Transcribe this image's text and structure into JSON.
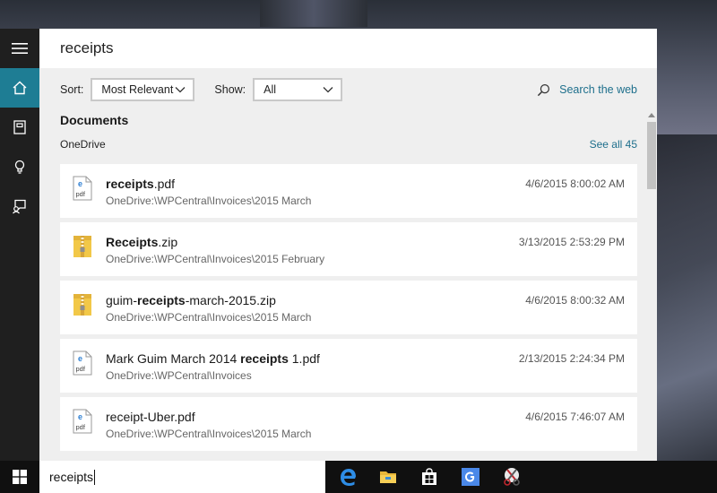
{
  "search": {
    "query": "receipts"
  },
  "filters": {
    "sort_label": "Sort:",
    "sort_value": "Most Relevant",
    "show_label": "Show:",
    "show_value": "All",
    "web_search_label": "Search the web"
  },
  "section": {
    "title": "Documents",
    "provider": "OneDrive",
    "see_all": "See all 45"
  },
  "results": [
    {
      "name_bold": "receipts",
      "name_after": ".pdf",
      "path": "OneDrive:\\WPCentral\\Invoices\\2015 March",
      "date": "4/6/2015 8:00:02 AM",
      "icon": "pdf-file-icon"
    },
    {
      "name_bold": "Receipts",
      "name_after": ".zip",
      "path": "OneDrive:\\WPCentral\\Invoices\\2015 February",
      "date": "3/13/2015 2:53:29 PM",
      "icon": "zip-folder-icon"
    },
    {
      "name_before": "guim-",
      "name_bold": "receipts",
      "name_after": "-march-2015.zip",
      "path": "OneDrive:\\WPCentral\\Invoices\\2015 March",
      "date": "4/6/2015 8:00:32 AM",
      "icon": "zip-folder-icon"
    },
    {
      "name_before": "Mark Guim March 2014 ",
      "name_bold": "receipts",
      "name_after": " 1.pdf",
      "path": "OneDrive:\\WPCentral\\Invoices",
      "date": "2/13/2015 2:24:34 PM",
      "icon": "pdf-file-icon"
    },
    {
      "name_before": "receipt-Uber.pdf",
      "path": "OneDrive:\\WPCentral\\Invoices\\2015 March",
      "date": "4/6/2015 7:46:07 AM",
      "icon": "pdf-file-icon"
    }
  ],
  "icon_text": {
    "pdf": "pdf"
  },
  "taskbar": {
    "search_text": "receipts"
  },
  "colors": {
    "accent": "#1e7d94",
    "link": "#1e6f8c",
    "rail": "#1f1f1f",
    "taskbar": "#101010"
  }
}
